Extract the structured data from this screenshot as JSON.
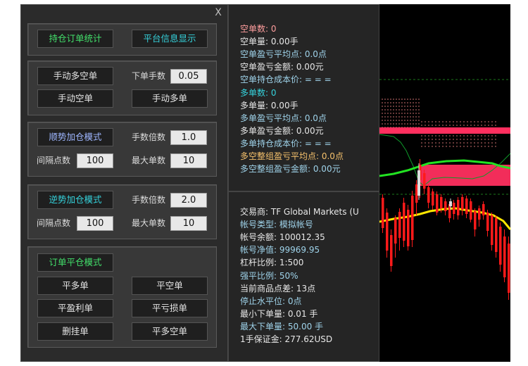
{
  "panel": {
    "close_label": "X",
    "group1": {
      "btn_positions": "持仓订单统计",
      "btn_platform": "平台信息显示"
    },
    "group2": {
      "btn_manual_longshort": "手动多空单",
      "lot_label": "下单手数",
      "lot_value": "0.05",
      "btn_manual_short": "手动空单",
      "btn_manual_long": "手动多单"
    },
    "group3": {
      "btn_trend_add": "顺势加仓模式",
      "mult_label": "手数倍数",
      "mult_value": "1.0",
      "interval_label": "间隔点数",
      "interval_value": "100",
      "max_label": "最大单数",
      "max_value": "10"
    },
    "group4": {
      "btn_counter_add": "逆势加仓模式",
      "mult_label": "手数倍数",
      "mult_value": "2.0",
      "interval_label": "间隔点数",
      "interval_value": "100",
      "max_label": "最大单数",
      "max_value": "10"
    },
    "group5": {
      "btn_close_mode": "订单平仓模式",
      "btn_close_long": "平多单",
      "btn_close_short": "平空单",
      "btn_close_profit": "平盈利单",
      "btn_close_loss": "平亏损单",
      "btn_delete_pending": "删挂单",
      "btn_close_longshort": "平多空单"
    }
  },
  "info_top": [
    {
      "text": "空单数: 0",
      "color": "#ff9e9e"
    },
    {
      "text": "空单量: 0.00手",
      "color": "#e8e8e8"
    },
    {
      "text": "空单盈亏平均点: 0.0点",
      "color": "#9fd3ea"
    },
    {
      "text": "空单盈亏金额: 0.00元",
      "color": "#e8e8e8"
    },
    {
      "text": "空单持仓成本价: = = =",
      "color": "#9fd3ea"
    },
    {
      "text": "多单数: 0",
      "color": "#35d3dd"
    },
    {
      "text": "多单量: 0.00手",
      "color": "#e8e8e8"
    },
    {
      "text": "多单盈亏平均点: 0.0点",
      "color": "#9fd3ea"
    },
    {
      "text": "多单盈亏金额: 0.00元",
      "color": "#e8e8e8"
    },
    {
      "text": "多单持仓成本价: = = =",
      "color": "#9fd3ea"
    },
    {
      "text": "多空整组盈亏平均点: 0.0点",
      "color": "#f5c16c"
    },
    {
      "text": "多空整组盈亏金额: 0.00元",
      "color": "#9fd3ea"
    }
  ],
  "info_bottom": [
    {
      "text": "交易商: TF Global Markets (U",
      "color": "#e8e8e8"
    },
    {
      "text": "帐号类型: 模拟帐号",
      "color": "#9fd3ea"
    },
    {
      "text": "帐号余额: 100012.35",
      "color": "#e8e8e8"
    },
    {
      "text": "帐号净值: 99969.95",
      "color": "#9fd3ea"
    },
    {
      "text": "杠杆比例: 1:500",
      "color": "#e8e8e8"
    },
    {
      "text": "强平比例: 50%",
      "color": "#9fd3ea"
    },
    {
      "text": "当前商品点差: 13点",
      "color": "#e8e8e8"
    },
    {
      "text": "停止水平位: 0点",
      "color": "#9fd3ea"
    },
    {
      "text": "最小下单量: 0.01 手",
      "color": "#e8e8e8"
    },
    {
      "text": "最大下单量: 50.00 手",
      "color": "#9fd3ea"
    },
    {
      "text": "1手保证金: 277.62USD",
      "color": "#e8e8e8"
    }
  ],
  "colors": {
    "panel_bg": "#2b2b2b",
    "green": "#43e06b",
    "cyan": "#35d3dd",
    "blue": "#9eb6ff",
    "candle_red": "#ff1a1a",
    "zone_red": "#ff2f5f",
    "ma_yellow": "#ffe600",
    "ma_green": "#22e322"
  }
}
